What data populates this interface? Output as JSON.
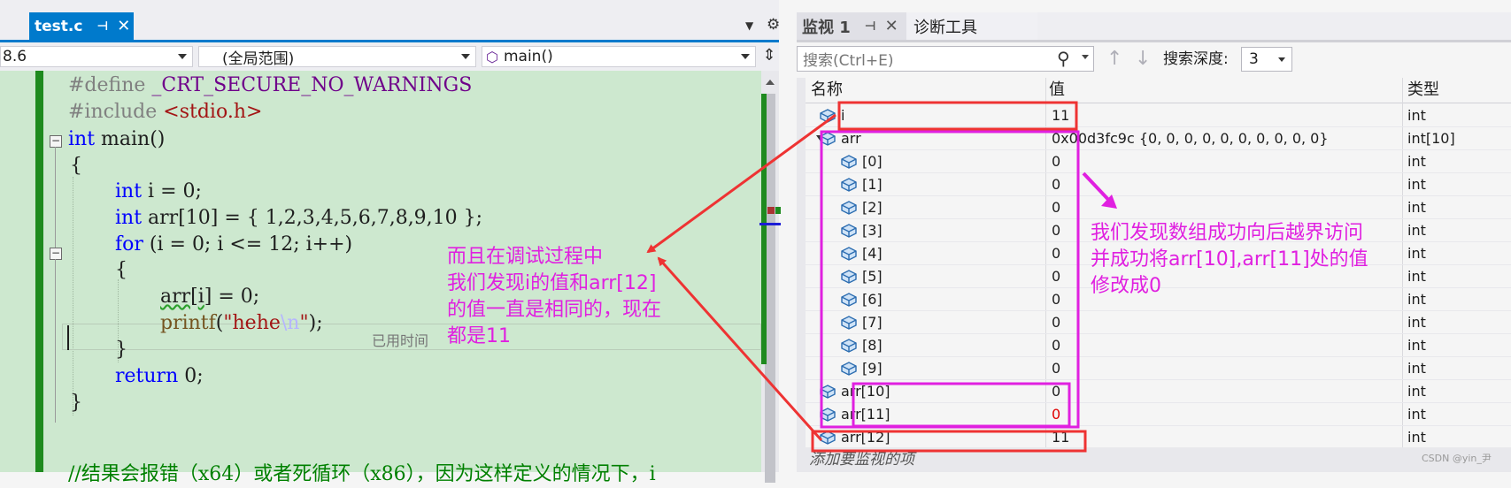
{
  "editor": {
    "tab_label": "test.c",
    "nav_project": "8.6",
    "nav_scope": "(全局范围)",
    "nav_function": "main()",
    "elapsed_hint": "已用时间"
  },
  "code_lines": [
    {
      "kind": "define",
      "directive": "#define",
      "name": "_CRT_SECURE_NO_WARNINGS"
    },
    {
      "kind": "include",
      "directive": "#include",
      "header": "<stdio.h>"
    },
    {
      "kind": "fn",
      "kw": "int",
      "rest": " main()"
    },
    {
      "kind": "plain",
      "text": "{"
    },
    {
      "kind": "decl",
      "kw": "int",
      "rest": " i = 0;"
    },
    {
      "kind": "decl",
      "kw": "int",
      "rest": " arr[10] = { 1,2,3,4,5,6,7,8,9,10 };"
    },
    {
      "kind": "decl",
      "kw": "for",
      "rest": " (i = 0; i <= 12; i++)"
    },
    {
      "kind": "plain",
      "text": "{"
    },
    {
      "kind": "assign",
      "pre": "arr[",
      "mid": "i",
      "post": "] = 0;"
    },
    {
      "kind": "printf",
      "fn": "printf",
      "a": "(",
      "s1": "\"hehe",
      "esc": "\\n",
      "s2": "\"",
      "b": ");"
    },
    {
      "kind": "plain",
      "text": "}"
    },
    {
      "kind": "decl",
      "kw": "return",
      "rest": " 0;"
    },
    {
      "kind": "plain",
      "text": "}"
    },
    {
      "kind": "plain",
      "text": ""
    },
    {
      "kind": "comment",
      "text": "//结果会报错（x64）或者死循环（x86），因为这样定义的情况下，i"
    }
  ],
  "watch": {
    "tab_label": "监视 1",
    "tab_diag": "诊断工具",
    "search_placeholder": "搜索(Ctrl+E)",
    "depth_label": "搜索深度:",
    "depth_value": "3",
    "col_name": "名称",
    "col_value": "值",
    "col_type": "类型",
    "add_watch": "添加要监视的项",
    "rows": [
      {
        "name": "i",
        "value": "11",
        "type": "int",
        "indent": 0,
        "expand": false
      },
      {
        "name": "arr",
        "value": "0x00d3fc9c {0, 0, 0, 0, 0, 0, 0, 0, 0, 0}",
        "type": "int[10]",
        "indent": 0,
        "expand": true
      },
      {
        "name": "[0]",
        "value": "0",
        "type": "int",
        "indent": 1
      },
      {
        "name": "[1]",
        "value": "0",
        "type": "int",
        "indent": 1
      },
      {
        "name": "[2]",
        "value": "0",
        "type": "int",
        "indent": 1
      },
      {
        "name": "[3]",
        "value": "0",
        "type": "int",
        "indent": 1
      },
      {
        "name": "[4]",
        "value": "0",
        "type": "int",
        "indent": 1
      },
      {
        "name": "[5]",
        "value": "0",
        "type": "int",
        "indent": 1
      },
      {
        "name": "[6]",
        "value": "0",
        "type": "int",
        "indent": 1
      },
      {
        "name": "[7]",
        "value": "0",
        "type": "int",
        "indent": 1
      },
      {
        "name": "[8]",
        "value": "0",
        "type": "int",
        "indent": 1
      },
      {
        "name": "[9]",
        "value": "0",
        "type": "int",
        "indent": 1
      },
      {
        "name": "arr[10]",
        "value": "0",
        "type": "int",
        "indent": 0
      },
      {
        "name": "arr[11]",
        "value": "0",
        "type": "int",
        "indent": 0,
        "changed": true
      },
      {
        "name": "arr[12]",
        "value": "11",
        "type": "int",
        "indent": 0
      }
    ]
  },
  "annotations": {
    "left": [
      "而且在调试过程中",
      "我们发现i的值和arr[12]",
      "的值一直是相同的，现在",
      "都是11"
    ],
    "right": [
      "我们发现数组成功向后越界访问",
      "并成功将arr[10],arr[11]处的值",
      "修改成0"
    ],
    "color_magenta": "#e020e0",
    "color_red": "#ee3333"
  },
  "watermark": "CSDN @yin_尹"
}
